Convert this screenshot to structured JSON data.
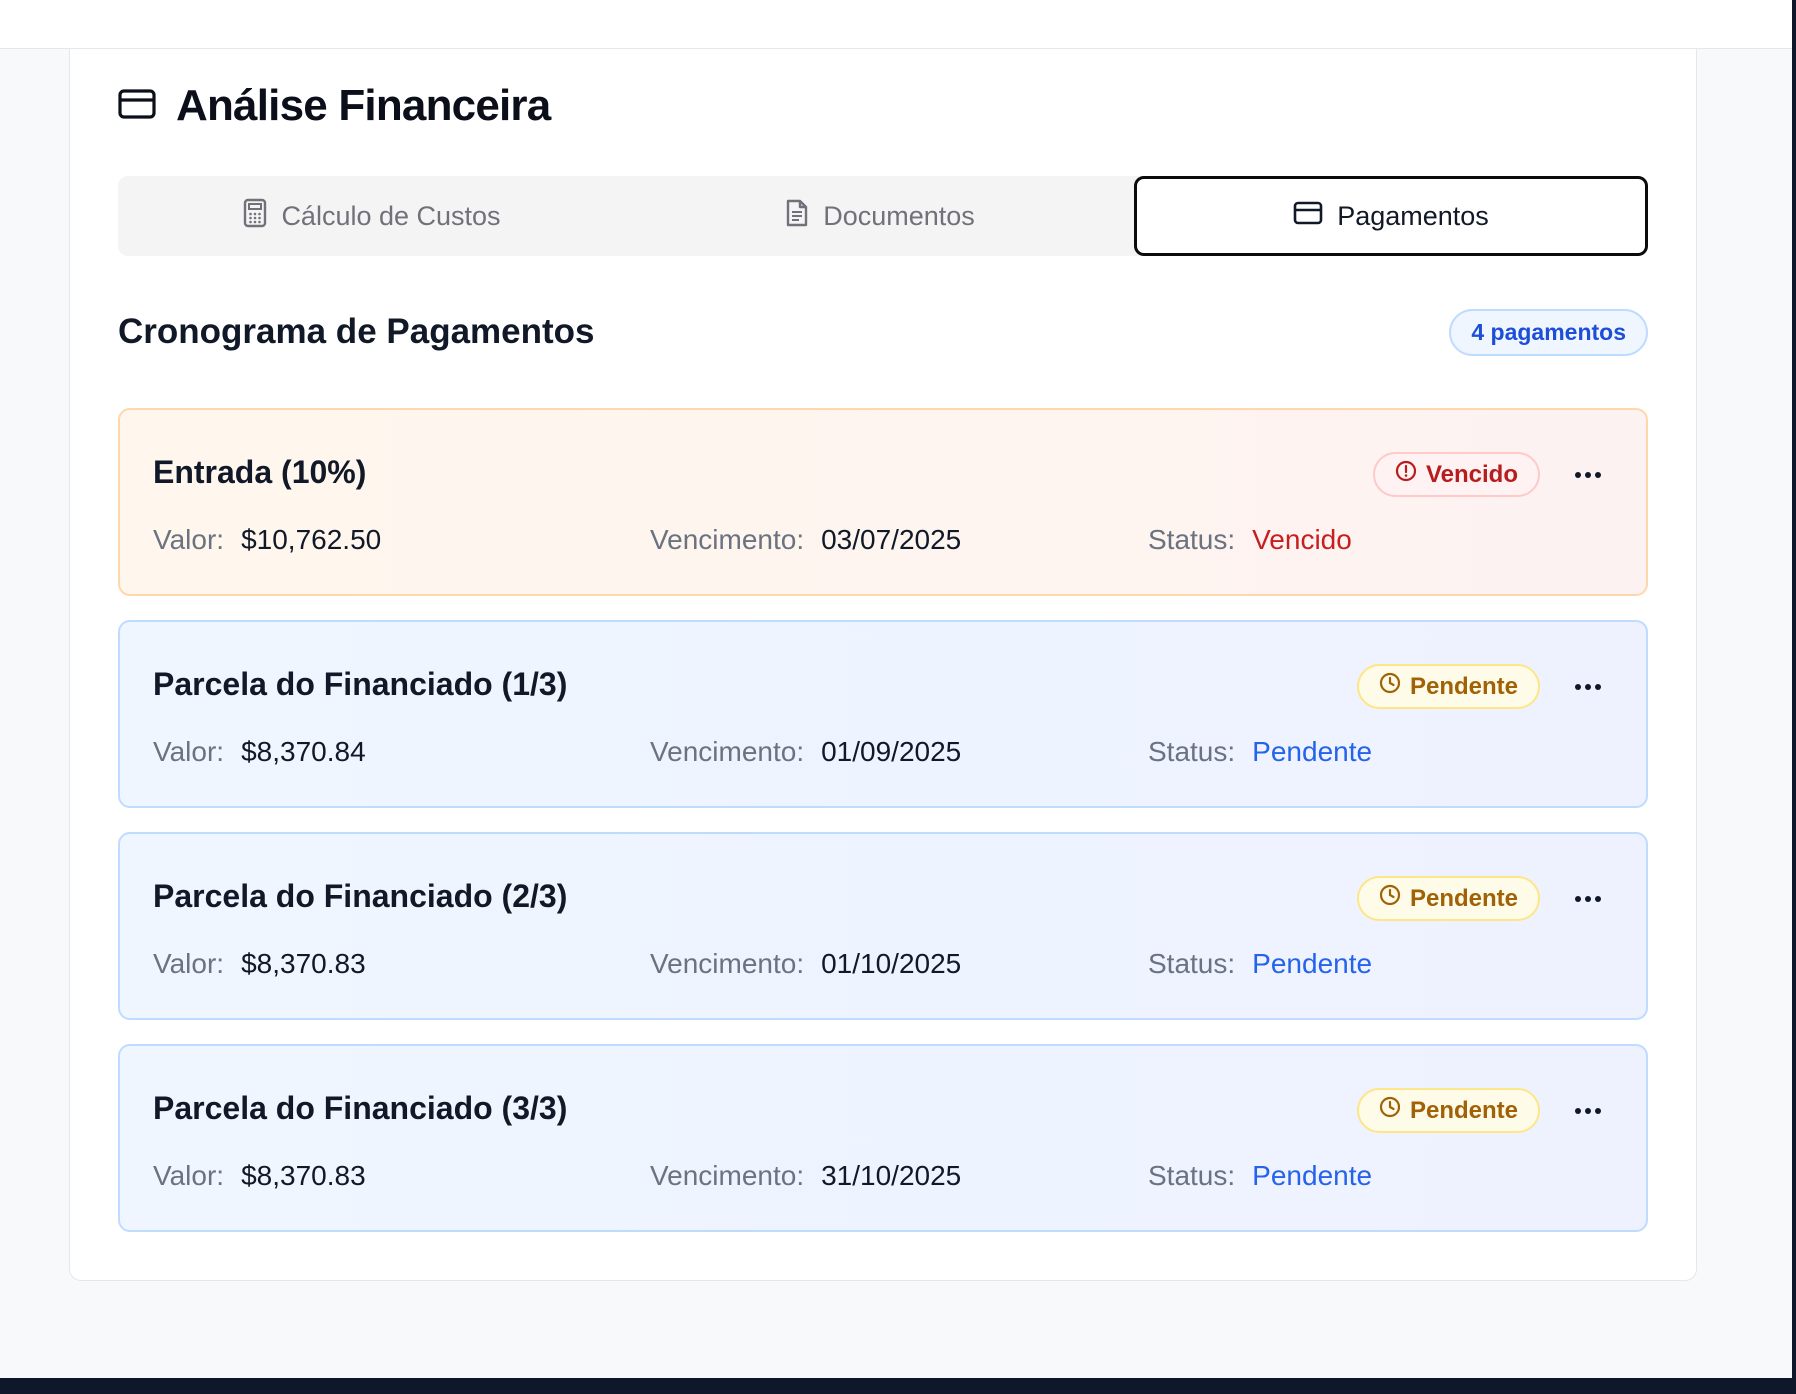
{
  "colors": {
    "overdue": "#c81e1e",
    "pending_text": "#2563eb",
    "pending_badge": "#a16207",
    "badge_blue": "#1d4ed8"
  },
  "header": {
    "title": "Análise Financeira",
    "icon": "credit-card-icon"
  },
  "tabs": [
    {
      "label": "Cálculo de Custos",
      "icon": "calculator-icon",
      "active": false
    },
    {
      "label": "Documentos",
      "icon": "file-text-icon",
      "active": false
    },
    {
      "label": "Pagamentos",
      "icon": "credit-card-icon",
      "active": true
    }
  ],
  "section": {
    "title": "Cronograma de Pagamentos",
    "count_badge": "4 pagamentos"
  },
  "labels": {
    "valor": "Valor:",
    "vencimento": "Vencimento:",
    "status": "Status:"
  },
  "payments": [
    {
      "title": "Entrada (10%)",
      "badge": "Vencido",
      "badge_icon": "alert-circle-icon",
      "valor": "$10,762.50",
      "vencimento": "03/07/2025",
      "status": "Vencido"
    },
    {
      "title": "Parcela do Financiado (1/3)",
      "badge": "Pendente",
      "badge_icon": "clock-icon",
      "valor": "$8,370.84",
      "vencimento": "01/09/2025",
      "status": "Pendente"
    },
    {
      "title": "Parcela do Financiado (2/3)",
      "badge": "Pendente",
      "badge_icon": "clock-icon",
      "valor": "$8,370.83",
      "vencimento": "01/10/2025",
      "status": "Pendente"
    },
    {
      "title": "Parcela do Financiado (3/3)",
      "badge": "Pendente",
      "badge_icon": "clock-icon",
      "valor": "$8,370.83",
      "vencimento": "31/10/2025",
      "status": "Pendente"
    }
  ]
}
